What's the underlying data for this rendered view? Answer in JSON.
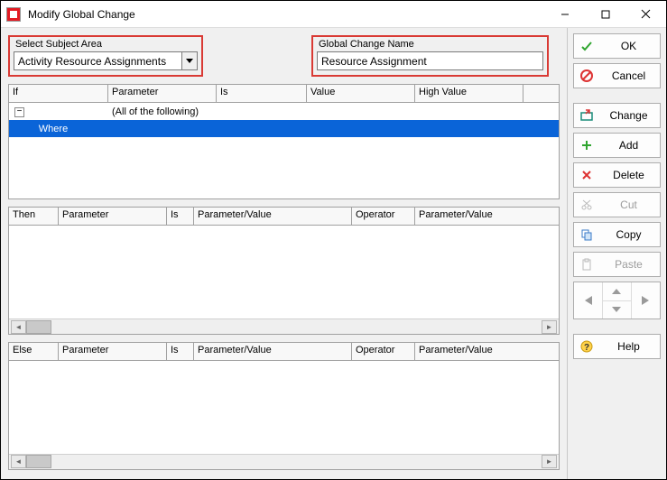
{
  "title": "Modify Global Change",
  "fields": {
    "subject_label": "Select Subject Area",
    "subject_value": "Activity Resource Assignments",
    "name_label": "Global Change Name",
    "name_value": "Resource Assignment"
  },
  "if_grid": {
    "headers": {
      "c0": "If",
      "c1": "Parameter",
      "c2": "Is",
      "c3": "Value",
      "c4": "High Value"
    },
    "row0_param": "(All of the following)",
    "row1_where": "Where"
  },
  "then_grid": {
    "headers": {
      "c0": "Then",
      "c1": "Parameter",
      "c2": "Is",
      "c3": "Parameter/Value",
      "c4": "Operator",
      "c5": "Parameter/Value"
    }
  },
  "else_grid": {
    "headers": {
      "c0": "Else",
      "c1": "Parameter",
      "c2": "Is",
      "c3": "Parameter/Value",
      "c4": "Operator",
      "c5": "Parameter/Value"
    }
  },
  "buttons": {
    "ok": "OK",
    "cancel": "Cancel",
    "change": "Change",
    "add": "Add",
    "delete": "Delete",
    "cut": "Cut",
    "copy": "Copy",
    "paste": "Paste",
    "help": "Help"
  }
}
